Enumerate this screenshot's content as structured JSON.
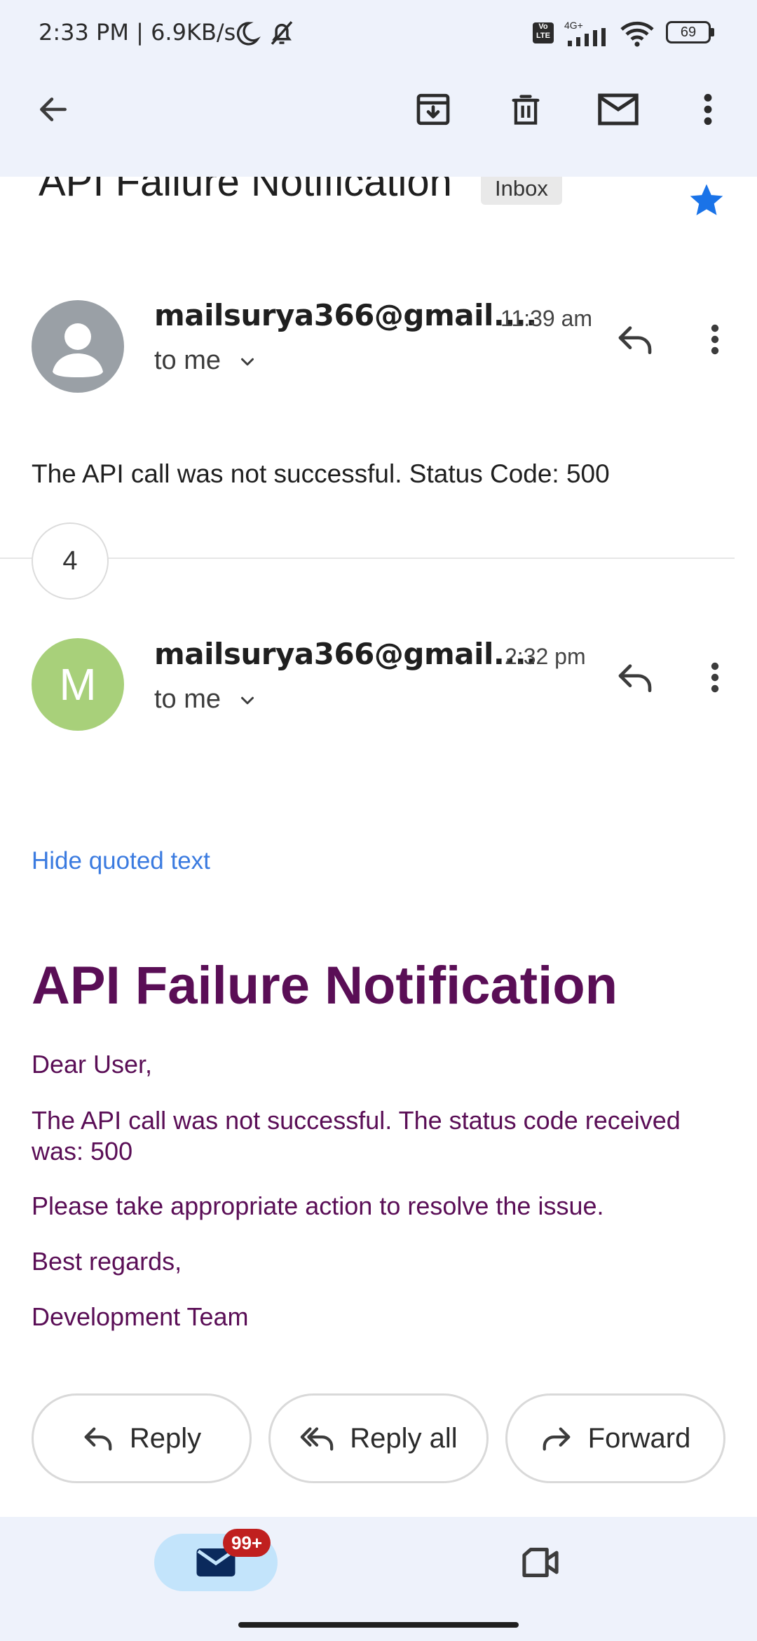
{
  "status_bar": {
    "text": "2:33 PM | 6.9KB/s",
    "network": "4G+",
    "battery": "69"
  },
  "toolbar": {
    "back_icon": "arrow-left-icon",
    "archive_icon": "archive-icon",
    "delete_icon": "trash-icon",
    "mark_unread_icon": "mail-icon",
    "more_icon": "more-vert-icon"
  },
  "email": {
    "subject": "API Failure Notification",
    "label": "Inbox",
    "starred": true,
    "messages": [
      {
        "sender": "mailsurya366@gmail....",
        "time": "11:39 am",
        "to": "to me",
        "snippet": "The API call was not successful. Status Code: 500",
        "avatar_color": "#9aa0a6"
      },
      {
        "sender": "mailsurya366@gmail....",
        "time": "2:32 pm",
        "to": "to me",
        "avatar_letter": "M",
        "avatar_color": "#a8d07a"
      }
    ],
    "collapsed_count": "4",
    "hide_quoted": "Hide quoted text",
    "body": {
      "title": "API Failure Notification",
      "greeting": "Dear User,",
      "line1": "The API call was not successful. The status code received was: 500",
      "line2": "Please take appropriate action to resolve the issue.",
      "closing": "Best regards,",
      "signature": "Development Team",
      "color": "#5a0e56"
    }
  },
  "actions": {
    "reply": "Reply",
    "reply_all": "Reply all",
    "forward": "Forward"
  },
  "bottom_nav": {
    "mail_badge": "99+",
    "mail_icon": "mail-icon",
    "meet_icon": "video-icon"
  },
  "colors": {
    "accent": "#1a73e8",
    "star": "#1a73e8",
    "link": "#3b7be0",
    "badge": "#c0201f",
    "nav_bg": "#eef2fb"
  }
}
